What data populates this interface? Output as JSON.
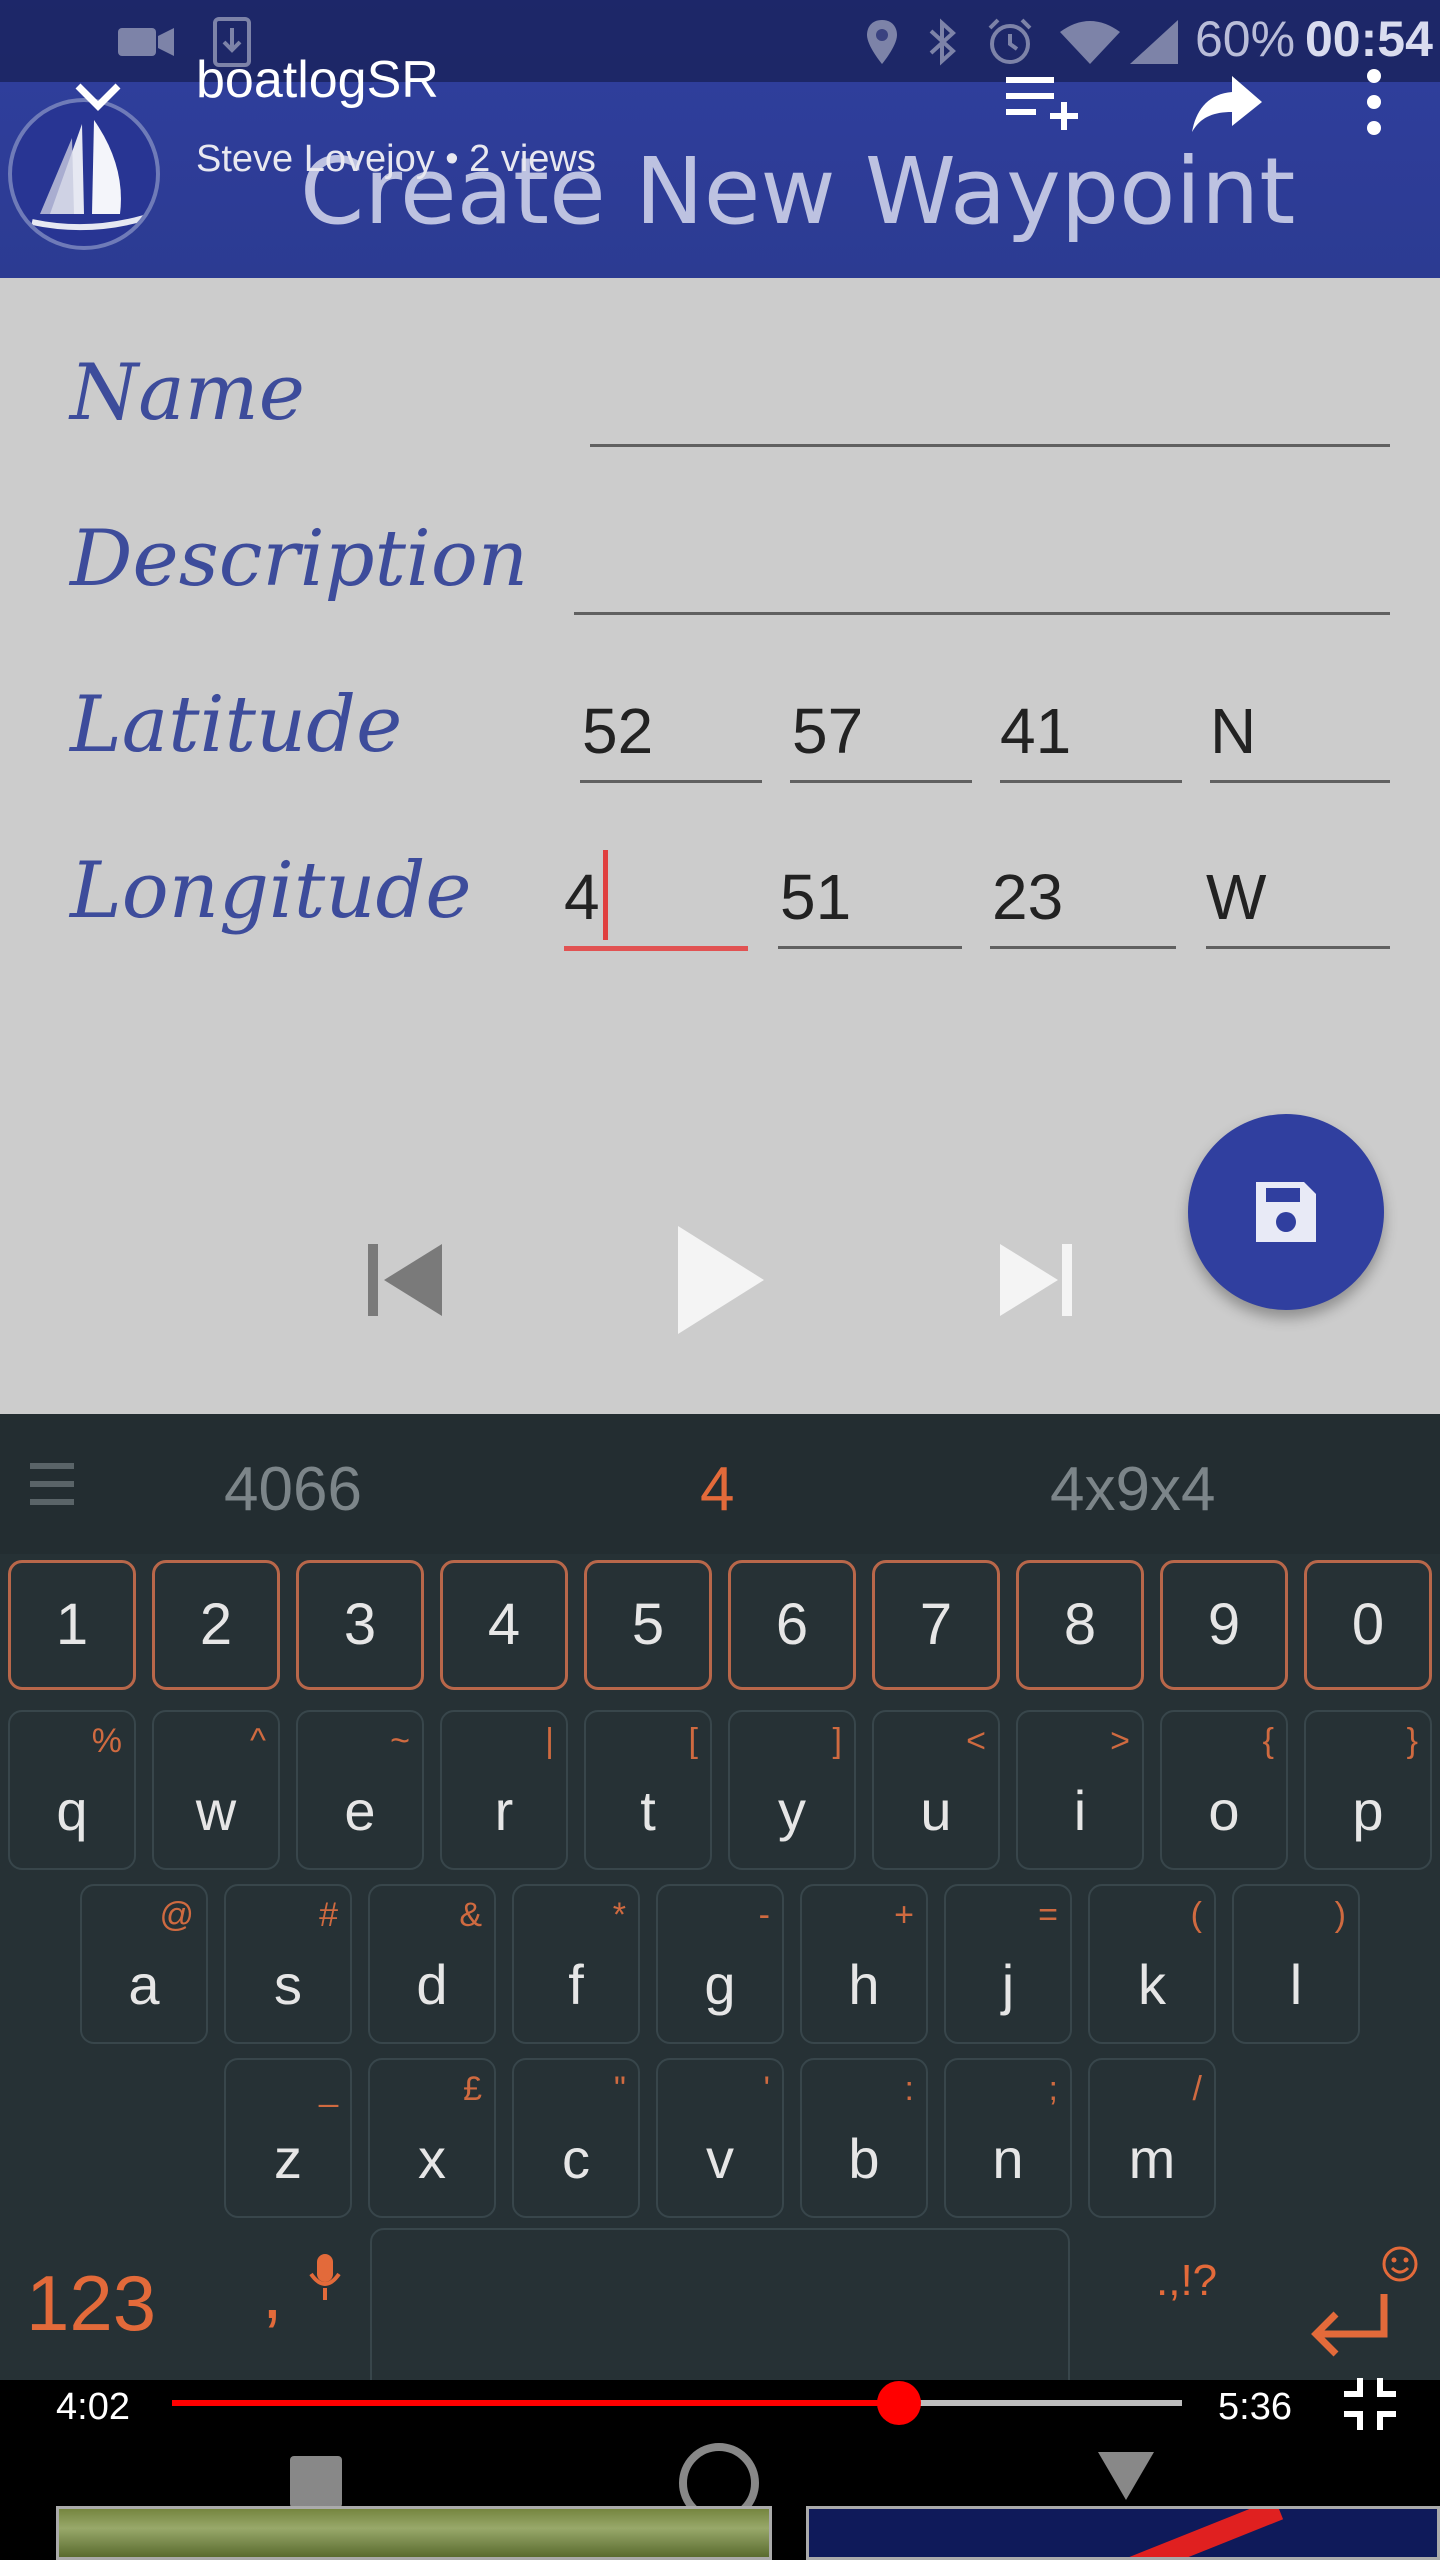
{
  "app": {
    "title": "Create New Waypoint",
    "logo": "sailboat-logo"
  },
  "status_bar": {
    "icons_left": [
      "video-camera-icon",
      "download-icon"
    ],
    "icons_right": [
      "location-icon",
      "bluetooth-icon",
      "alarm-icon",
      "wifi-icon",
      "signal-icon"
    ],
    "battery": "60%",
    "clock": "00:54"
  },
  "video": {
    "title": "boatlogSR",
    "subtitle": "Steve Lovejoy • 2 views",
    "current_time": "4:02",
    "total_time": "5:36",
    "progress": 0.7194
  },
  "form": {
    "name": {
      "label": "Name",
      "value": ""
    },
    "description": {
      "label": "Description",
      "value": ""
    },
    "latitude": {
      "label": "Latitude",
      "deg": "52",
      "min": "57",
      "sec": "41",
      "hemi": "N"
    },
    "longitude": {
      "label": "Longitude",
      "deg": "4",
      "min": "51",
      "sec": "23",
      "hemi": "W"
    }
  },
  "keyboard": {
    "suggestions": [
      "4066",
      "4",
      "4x9x4"
    ],
    "number_row": [
      "1",
      "2",
      "3",
      "4",
      "5",
      "6",
      "7",
      "8",
      "9",
      "0"
    ],
    "row1": [
      {
        "k": "q",
        "s": "%"
      },
      {
        "k": "w",
        "s": "^"
      },
      {
        "k": "e",
        "s": "~"
      },
      {
        "k": "r",
        "s": "|"
      },
      {
        "k": "t",
        "s": "["
      },
      {
        "k": "y",
        "s": "]"
      },
      {
        "k": "u",
        "s": "<"
      },
      {
        "k": "i",
        "s": ">"
      },
      {
        "k": "o",
        "s": "{"
      },
      {
        "k": "p",
        "s": "}"
      }
    ],
    "row2": [
      {
        "k": "a",
        "s": "@"
      },
      {
        "k": "s",
        "s": "#"
      },
      {
        "k": "d",
        "s": "&"
      },
      {
        "k": "f",
        "s": "*"
      },
      {
        "k": "g",
        "s": "-"
      },
      {
        "k": "h",
        "s": "+"
      },
      {
        "k": "j",
        "s": "="
      },
      {
        "k": "k",
        "s": "("
      },
      {
        "k": "l",
        "s": ")"
      }
    ],
    "row3": [
      {
        "k": "z",
        "s": "_"
      },
      {
        "k": "x",
        "s": "£"
      },
      {
        "k": "c",
        "s": "\""
      },
      {
        "k": "v",
        "s": "'"
      },
      {
        "k": "b",
        "s": ":"
      },
      {
        "k": "n",
        "s": ";"
      },
      {
        "k": "m",
        "s": "/"
      }
    ],
    "comma": ",",
    "punct": ".,!?",
    "mode": "123"
  },
  "colors": {
    "accent": "#e36a3a",
    "app_bar": "#303f9f",
    "label": "#3d4c9b",
    "seek": "#ff0000"
  }
}
